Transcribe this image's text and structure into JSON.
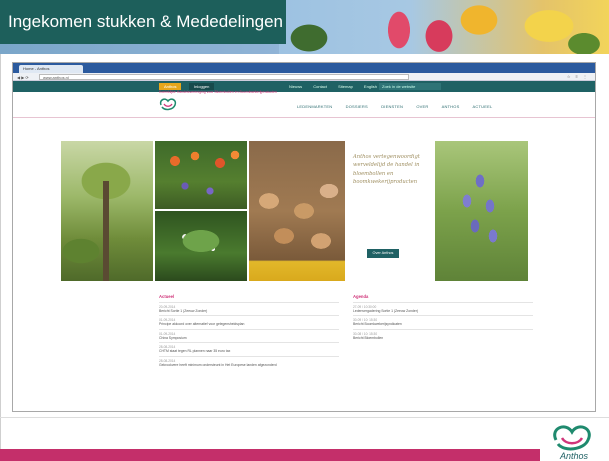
{
  "slide": {
    "title": "Ingekomen stukken & Mededelingen",
    "bottom_bar_color": "#c42f6a",
    "title_box_color": "#1d5f5b"
  },
  "browser": {
    "tab_title": "Home - Anthos",
    "url": "www.anthos.nl",
    "nav": "◀ ▶ ⟳",
    "toolbar_icons": "☆ ≡ ⋮"
  },
  "site": {
    "top_pills": [
      "Anthos",
      "Inloggen"
    ],
    "top_links": "Nieuws Contact Sitemap English",
    "search_placeholder": "Zoek in de website",
    "menu": [
      "LEDENMARKTEN",
      "DOSSIERS",
      "DIENSTEN",
      "OVER ANTHOS",
      "ACTUEEL"
    ],
    "tagline": "Koninklijke Handelsvereniging voor Bloembollen en Boomkwekerijproducten",
    "hero_quote": "Anthos vertegenwoordigt werveldelijd de handel in bloembollen en boomkwekerijproducten",
    "hero_button": "Over Anthos"
  },
  "news": {
    "heading": "Actueel",
    "items": [
      {
        "date": "20-09-2014",
        "title": "Bericht Sortie 1 (Zeeuw Zonder)"
      },
      {
        "date": "01-09-2014",
        "title": "Principe akkoord over alternatief voor gelegensheidsplan"
      },
      {
        "date": "01-09-2014",
        "title": "China Symposium"
      },
      {
        "date": "28-08-2014",
        "title": "CHTM staat tegen RL plannen naar 35 euro tax"
      },
      {
        "date": "28-08-2014",
        "title": "Gekrookvere heeft minimum ondersteunt in Het Europese landen afgezonderd"
      }
    ]
  },
  "agenda": {
    "heading": "Agenda",
    "items": [
      {
        "date": "27-09 / 10:30:00",
        "title": "Ledenvergadering Sortie 1 (Zeeuw Zonder)"
      },
      {
        "date": "30-09 / 10: 15:30",
        "title": "Bericht Boomkwekerijsyndicaten"
      },
      {
        "date": "30-08 / 10: 15:30",
        "title": "Bericht Bloembollen"
      }
    ]
  },
  "logo_text": "Anthos"
}
